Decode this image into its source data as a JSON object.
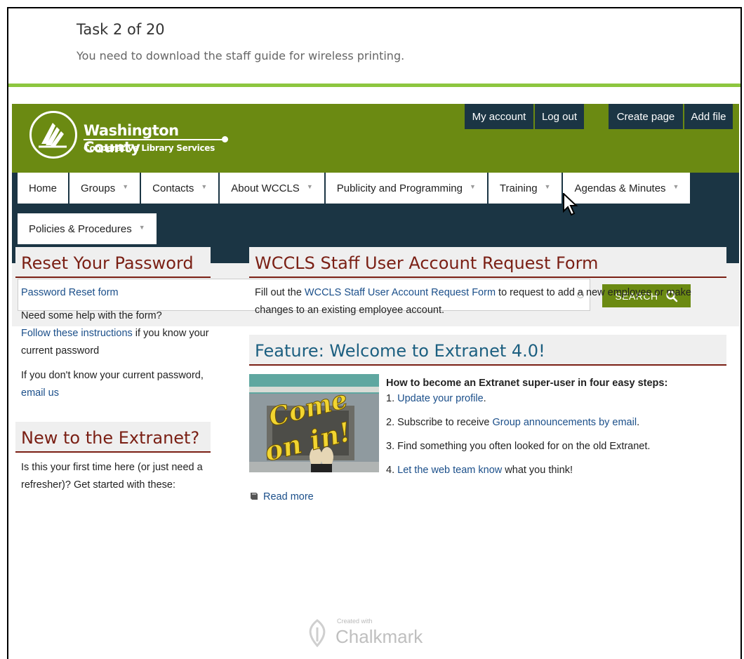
{
  "task": {
    "title": "Task 2 of 20",
    "description": "You need to download the staff guide for wireless printing."
  },
  "logo": {
    "title": "Washington County",
    "subtitle": "Cooperative Library Services"
  },
  "top_buttons": {
    "my_account": "My account",
    "log_out": "Log out",
    "create_page": "Create page",
    "add_file": "Add file"
  },
  "nav": {
    "items": [
      {
        "label": "Home",
        "dropdown": false
      },
      {
        "label": "Groups",
        "dropdown": true
      },
      {
        "label": "Contacts",
        "dropdown": true
      },
      {
        "label": "About WCCLS",
        "dropdown": true
      },
      {
        "label": "Publicity and Programming",
        "dropdown": true
      },
      {
        "label": "Training",
        "dropdown": true
      },
      {
        "label": "Agendas & Minutes",
        "dropdown": true
      },
      {
        "label": "Policies & Procedures",
        "dropdown": true
      }
    ]
  },
  "search": {
    "value": "",
    "button_label": "SEARCH"
  },
  "left": {
    "reset_heading": "Reset Your Password",
    "reset_link": "Password Reset form",
    "help_text_1": "Need some help with the form?",
    "help_link": "Follow these instructions",
    "help_text_2": " if you know your current password",
    "dont_know_text": "If you don't know your current password, ",
    "email_link": "email us",
    "new_heading": "New to the Extranet?",
    "new_text": "Is this your first time here (or just need a refresher)?  Get started with these:"
  },
  "right": {
    "form_heading": "WCCLS Staff User Account Request Form",
    "form_text_1": "Fill out the ",
    "form_link": "WCCLS Staff User Account Request Form",
    "form_text_2": " to request to add a new employee or make changes to an existing employee account.",
    "feature_heading": "Feature: Welcome to Extranet 4.0!",
    "image_text_1": "Come",
    "image_text_2": "on in!",
    "steps_title": "How to become an Extranet super-user in four easy steps:",
    "step1_prefix": "1. ",
    "step1_link": "Update your profile",
    "step1_suffix": ".",
    "step2_prefix": "2. Subscribe to receive ",
    "step2_link": "Group announcements by email",
    "step2_suffix": ".",
    "step3": "3. Find something you often looked for on the old Extranet.",
    "step4_prefix": "4. ",
    "step4_link": "Let the web team know",
    "step4_suffix": " what you think!",
    "read_more": "Read more"
  },
  "watermark": {
    "small": "Created with",
    "brand": "Chalkmark"
  },
  "colors": {
    "banner_green": "#6b8a12",
    "nav_dark": "#1b3544",
    "heading_red": "#7a1f14",
    "link_blue": "#1b4f8a",
    "task_rule": "#8dc63f"
  }
}
